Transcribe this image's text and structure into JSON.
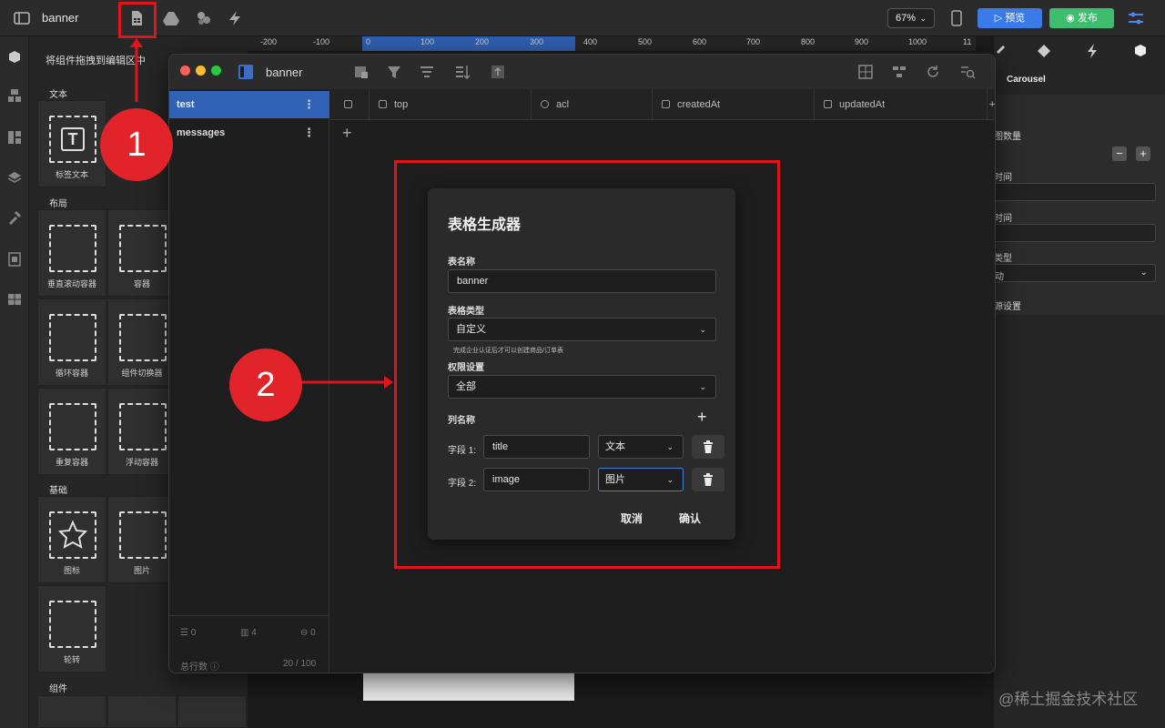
{
  "app": {
    "title": "banner",
    "zoom": "67%",
    "preview_label": "预览",
    "publish_label": "发布"
  },
  "panel": {
    "hint": "将组件拖拽到编辑区中",
    "sections": [
      {
        "label": "文本",
        "tiles": [
          "标签文本"
        ]
      },
      {
        "label": "布局",
        "tiles": [
          "垂直滚动容器",
          "容器",
          "循环容器",
          "组件切换器",
          "重复容器",
          "浮动容器"
        ]
      },
      {
        "label": "基础",
        "tiles": [
          "图标",
          "图片",
          "轮转"
        ]
      },
      {
        "label": "组件",
        "tiles": []
      }
    ]
  },
  "ruler": {
    "ticks": [
      "-200",
      "-100",
      "0",
      "100",
      "200",
      "300",
      "400",
      "500",
      "600",
      "700",
      "800",
      "900",
      "1000",
      "11"
    ]
  },
  "props": {
    "component": "Carousel",
    "rows": [
      "图数量",
      "时间",
      "时间",
      "类型",
      "动",
      "源设置"
    ]
  },
  "window": {
    "title": "banner",
    "tables": [
      {
        "name": "test",
        "active": true
      },
      {
        "name": "messages",
        "active": false
      }
    ],
    "columns": [
      "top",
      "acl",
      "createdAt",
      "updatedAt"
    ],
    "stats": {
      "rows_icon_count": "0",
      "cols_count": "4",
      "links_count": "0"
    },
    "total_rows_label": "总行数",
    "total_rows_value": "20 / 100",
    "progress": 0.2
  },
  "dialog": {
    "title": "表格生成器",
    "table_name_label": "表名称",
    "table_name_value": "banner",
    "table_type_label": "表格类型",
    "table_type_value": "自定义",
    "table_type_hint": "完成企业认证后才可以创建商品/订单表",
    "permission_label": "权限设置",
    "permission_value": "全部",
    "column_name_label": "列名称",
    "fields": [
      {
        "label": "字段 1:",
        "value": "title",
        "type": "文本"
      },
      {
        "label": "字段 2:",
        "value": "image",
        "type": "图片"
      }
    ],
    "cancel_label": "取消",
    "confirm_label": "确认"
  },
  "annotations": {
    "step1": "1",
    "step2": "2"
  },
  "watermark": "@稀土掘金技术社区",
  "colors": {
    "accent": "#3162b5",
    "annotation": "#e0141a",
    "publish": "#3dbd6e",
    "preview": "#3b7be8"
  }
}
